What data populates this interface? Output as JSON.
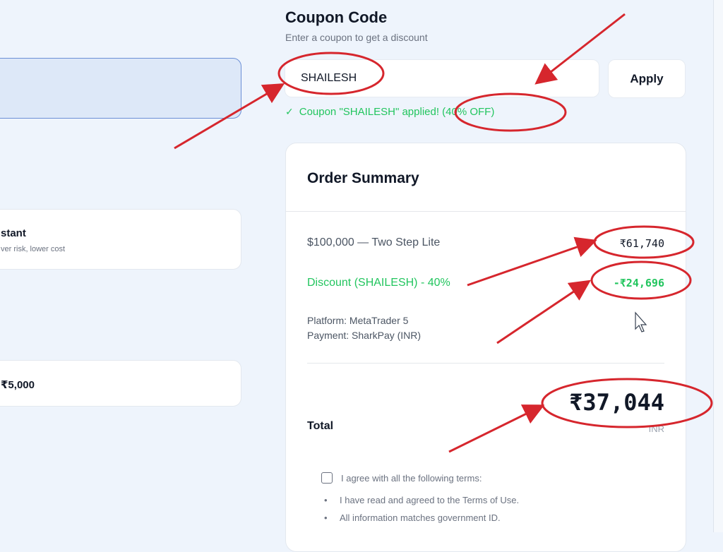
{
  "left": {
    "card_a_title": "stant",
    "card_a_subtitle": "ver risk, lower cost",
    "card_b_title": "₹5,000"
  },
  "coupon": {
    "title": "Coupon Code",
    "subtitle": "Enter a coupon to get a discount",
    "input_value": "SHAILESH",
    "apply_label": "Apply",
    "success_icon": "✓",
    "success_text": "Coupon \"SHAILESH\" applied! (40% OFF)"
  },
  "summary": {
    "title": "Order Summary",
    "plan_label": "$100,000 — Two Step Lite",
    "plan_price": "₹61,740",
    "discount_label": "Discount (SHAILESH) - 40%",
    "discount_price": "-₹24,696",
    "platform": "Platform: MetaTrader 5",
    "payment": "Payment: SharkPay (INR)",
    "total_label": "Total",
    "total_amount": "₹37,044",
    "total_currency": "INR",
    "terms_header": "I agree with all the following terms:",
    "terms": [
      "I have read and agreed to the Terms of Use.",
      "All information matches government ID."
    ]
  },
  "colors": {
    "accent_green": "#22c55e",
    "annotation_red": "#d6262d"
  }
}
